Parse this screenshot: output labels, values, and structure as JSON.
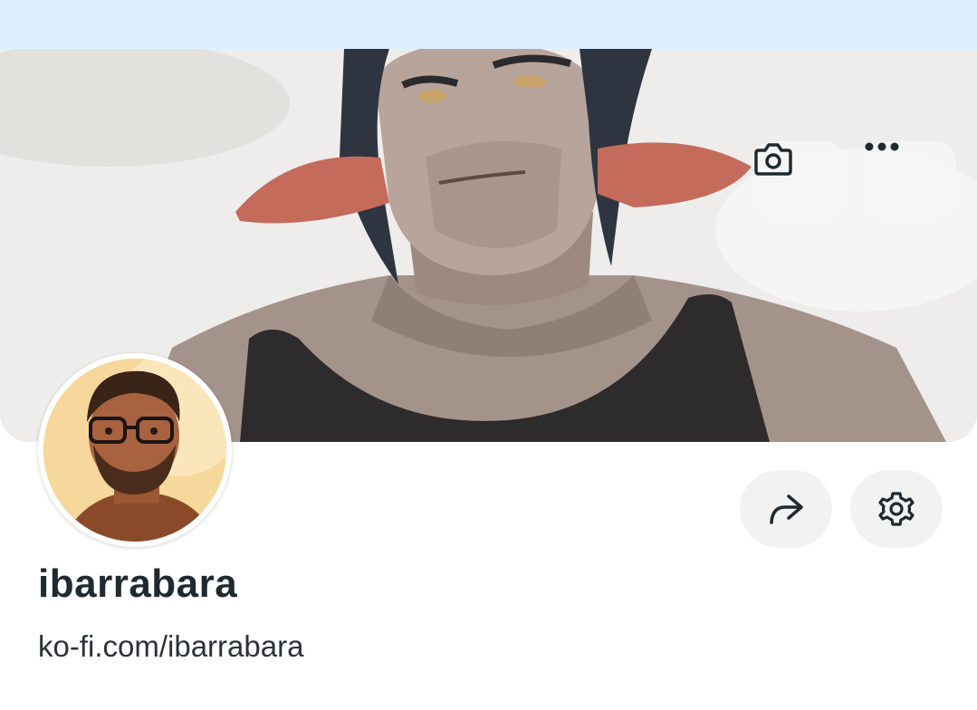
{
  "profile": {
    "name": "ibarrabara",
    "url": "ko-fi.com/ibarrabara"
  },
  "banner": {
    "camera_icon": "camera-icon",
    "more_icon": "more-horizontal-icon"
  },
  "actions": {
    "share_icon": "share-arrow-icon",
    "settings_icon": "gear-icon"
  },
  "colors": {
    "top_bar": "#ddefff",
    "button_bg": "#f2f2f2",
    "name_text": "#1f2a30"
  }
}
